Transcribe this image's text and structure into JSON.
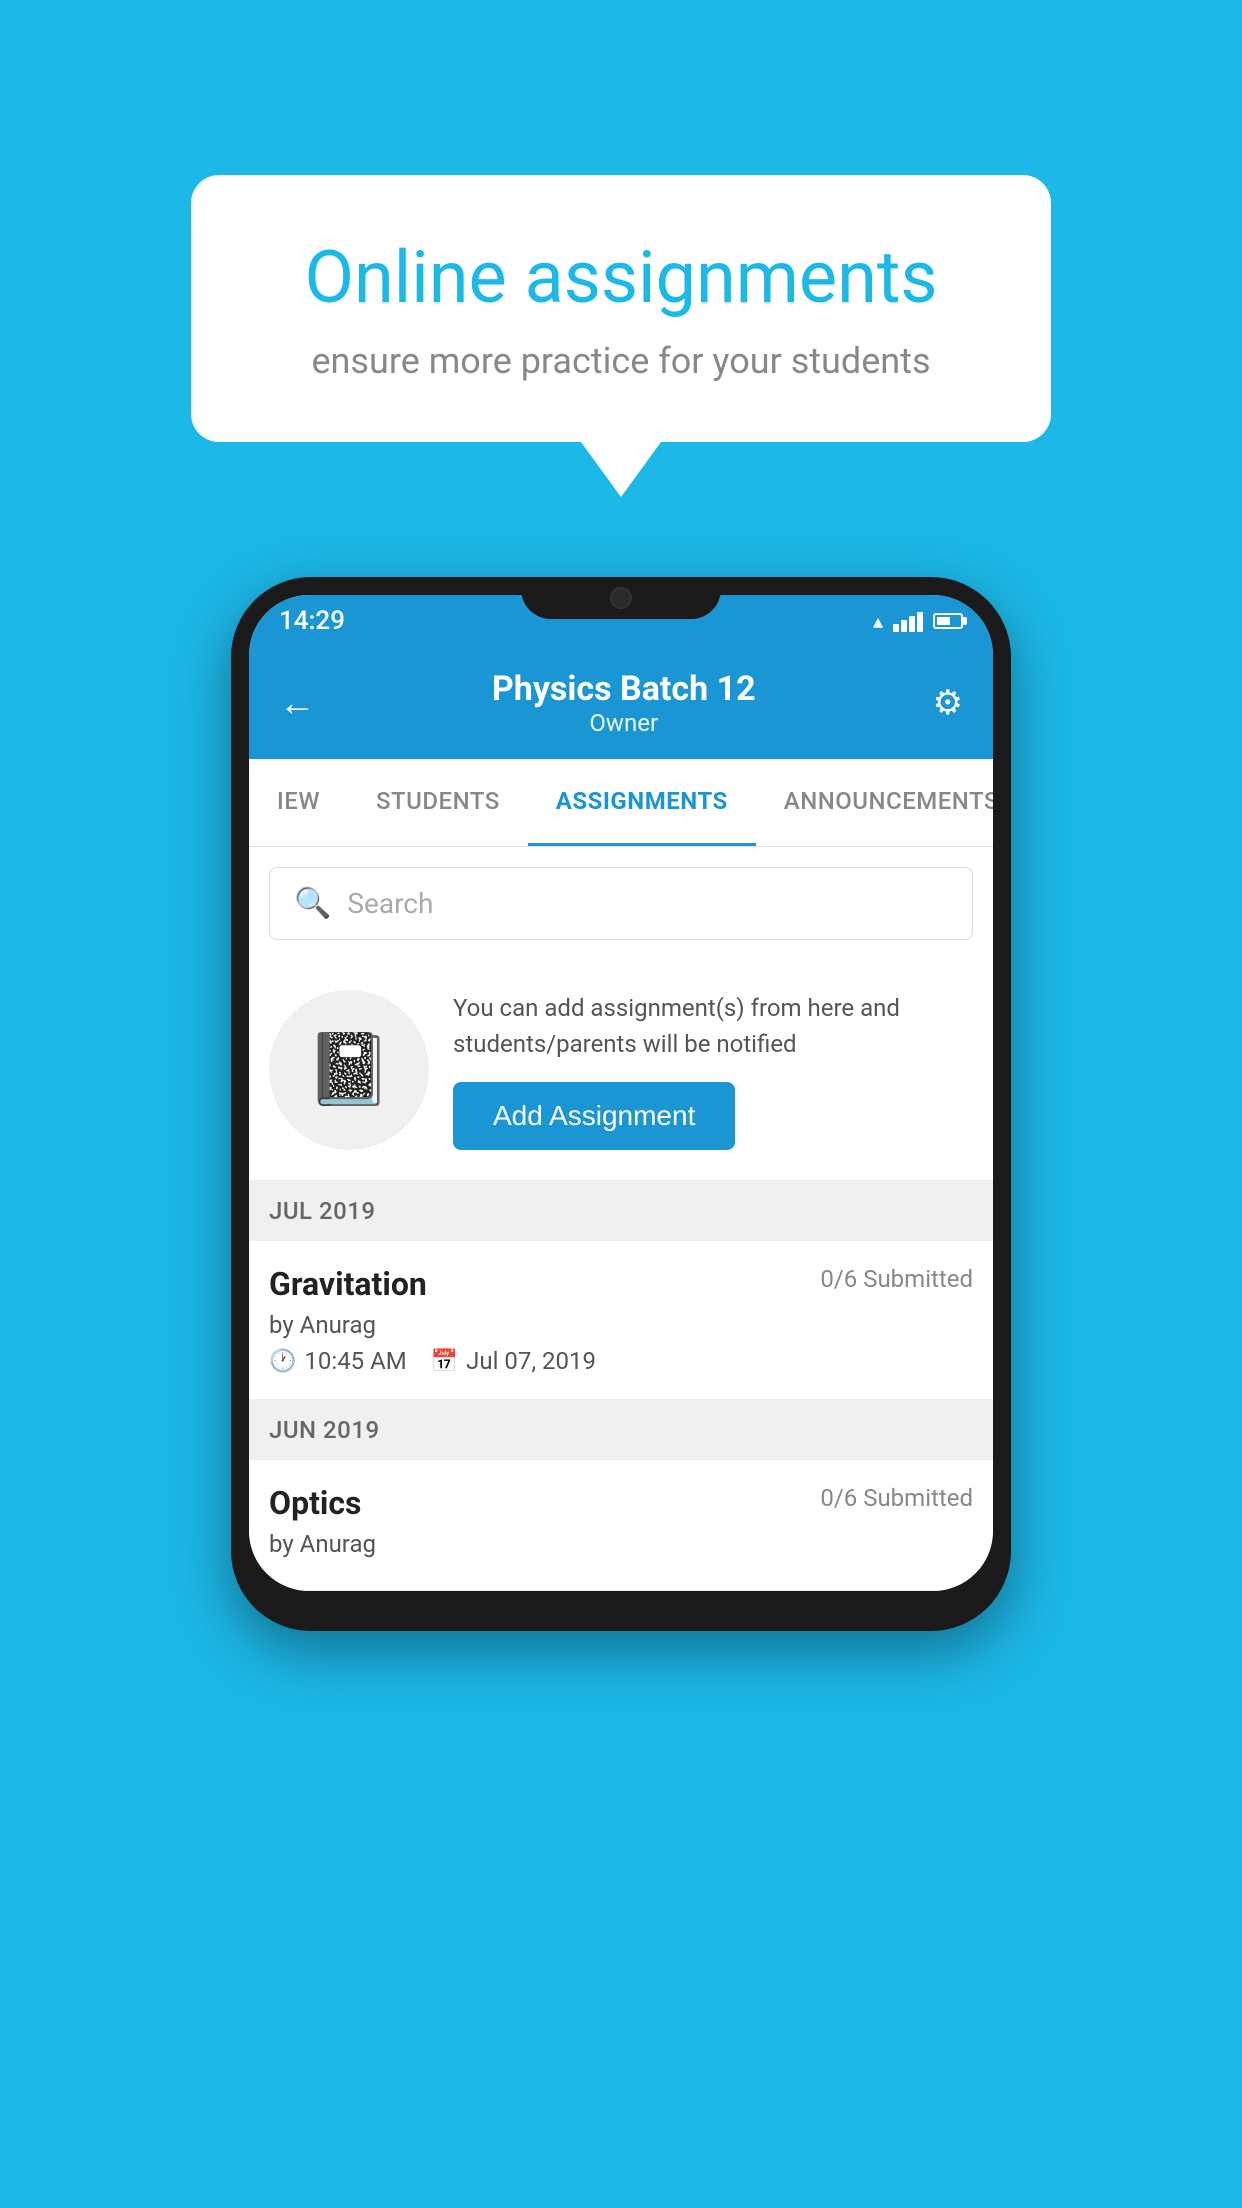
{
  "background": {
    "color": "#1cb8e8"
  },
  "speech_bubble": {
    "title": "Online assignments",
    "subtitle": "ensure more practice for your students"
  },
  "status_bar": {
    "time": "14:29"
  },
  "app_header": {
    "title": "Physics Batch 12",
    "subtitle": "Owner",
    "back_label": "←",
    "settings_label": "⚙"
  },
  "tabs": [
    {
      "id": "iew",
      "label": "IEW",
      "active": false
    },
    {
      "id": "students",
      "label": "STUDENTS",
      "active": false
    },
    {
      "id": "assignments",
      "label": "ASSIGNMENTS",
      "active": true
    },
    {
      "id": "announcements",
      "label": "ANNOUNCEMENTS",
      "active": false
    }
  ],
  "search": {
    "placeholder": "Search"
  },
  "add_assignment_promo": {
    "description": "You can add assignment(s) from here and students/parents will be notified",
    "button_label": "Add Assignment"
  },
  "sections": [
    {
      "label": "JUL 2019",
      "assignments": [
        {
          "name": "Gravitation",
          "submitted": "0/6 Submitted",
          "author": "by Anurag",
          "time": "10:45 AM",
          "date": "Jul 07, 2019"
        }
      ]
    },
    {
      "label": "JUN 2019",
      "assignments": [
        {
          "name": "Optics",
          "submitted": "0/6 Submitted",
          "author": "by Anurag",
          "time": "",
          "date": ""
        }
      ]
    }
  ]
}
